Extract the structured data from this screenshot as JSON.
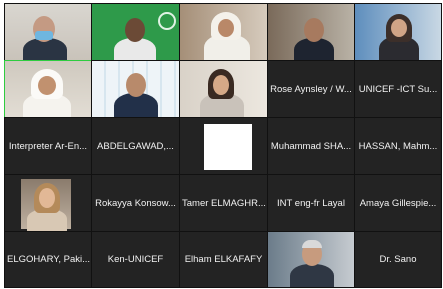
{
  "participants": [
    {
      "name": "",
      "video": true
    },
    {
      "name": "",
      "video": true
    },
    {
      "name": "",
      "video": true
    },
    {
      "name": "",
      "video": true
    },
    {
      "name": "",
      "video": true
    },
    {
      "name": "",
      "video": true
    },
    {
      "name": "",
      "video": true
    },
    {
      "name": "",
      "video": true
    },
    {
      "name": "Rose Aynsley / W...",
      "video": false
    },
    {
      "name": "UNICEF -ICT Su...",
      "video": false
    },
    {
      "name": "Interpreter Ar-En...",
      "video": false
    },
    {
      "name": "ABDELGAWAD,...",
      "video": false
    },
    {
      "name": "",
      "video": false
    },
    {
      "name": "Muhammad SHA...",
      "video": false
    },
    {
      "name": "HASSAN, Mahm...",
      "video": false
    },
    {
      "name": "",
      "video": true
    },
    {
      "name": "Rokayya Konsow...",
      "video": false
    },
    {
      "name": "Tamer ELMAGHR...",
      "video": false
    },
    {
      "name": "INT eng-fr Layal",
      "video": false
    },
    {
      "name": "Amaya Gillespie...",
      "video": false
    },
    {
      "name": "ELGOHARY, Paki...",
      "video": false
    },
    {
      "name": "Ken-UNICEF",
      "video": false
    },
    {
      "name": "Elham ELKAFAFY",
      "video": false
    },
    {
      "name": "",
      "video": true
    },
    {
      "name": "Dr. Sano",
      "video": false
    }
  ],
  "colors": {
    "tile_bg": "#232323",
    "active_speaker_border": "#2ecc40",
    "label_text": "#f2f2f2"
  }
}
